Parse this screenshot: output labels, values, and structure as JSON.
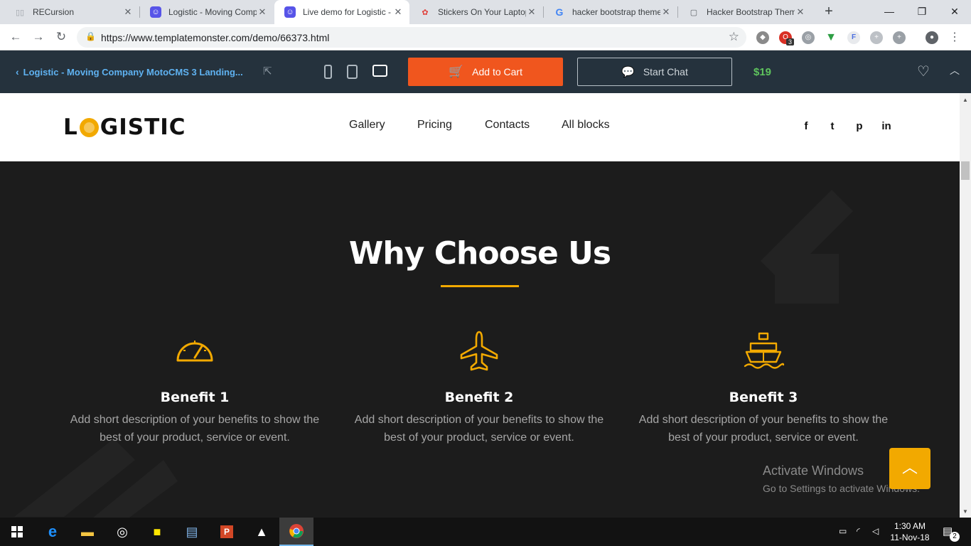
{
  "browser": {
    "tabs": [
      {
        "title": "RECursion",
        "favicon": "notebook-icon",
        "active": false
      },
      {
        "title": "Logistic - Moving Comp",
        "favicon": "templatemonster-icon",
        "active": false
      },
      {
        "title": "Live demo for Logistic -",
        "favicon": "templatemonster-icon",
        "active": true
      },
      {
        "title": "Stickers On Your Laptop",
        "favicon": "stickers-icon",
        "active": false
      },
      {
        "title": "hacker bootstrap theme",
        "favicon": "google-icon",
        "active": false
      },
      {
        "title": "Hacker Bootstrap Them",
        "favicon": "document-icon",
        "active": false
      }
    ],
    "new_tab": "+",
    "url": "https://www.templatemonster.com/demo/66373.html",
    "extension_badge": "3"
  },
  "demo_bar": {
    "back_title": "Logistic - Moving Company MotoCMS 3 Landing...",
    "add_to_cart": "Add to Cart",
    "start_chat": "Start Chat",
    "price": "$19"
  },
  "site": {
    "logo": {
      "pre": "L",
      "post": "GISTIC"
    },
    "nav": [
      "Gallery",
      "Pricing",
      "Contacts",
      "All blocks"
    ],
    "social": [
      "f",
      "t",
      "p",
      "in"
    ]
  },
  "section": {
    "title": "Why Choose Us",
    "benefits": [
      {
        "title": "Benefit 1",
        "text": "Add short description of your benefits to show the best of your product, service or event.",
        "icon": "speedometer-icon"
      },
      {
        "title": "Benefit 2",
        "text": "Add short description of your benefits to show the best of your product, service or event.",
        "icon": "airplane-icon"
      },
      {
        "title": "Benefit 3",
        "text": "Add short description of your benefits to show the best of your product, service or event.",
        "icon": "cargo-ship-icon"
      }
    ]
  },
  "watermark": {
    "line1": "Activate Windows",
    "line2": "Go to Settings to activate Windows."
  },
  "taskbar": {
    "time": "1:30 AM",
    "date": "11-Nov-18",
    "notifications": "2"
  },
  "colors": {
    "accent": "#f2a900",
    "cart": "#f0561e",
    "price": "#5ec35d",
    "demo_bar": "#25323d",
    "section_bg": "#1c1c1c"
  }
}
